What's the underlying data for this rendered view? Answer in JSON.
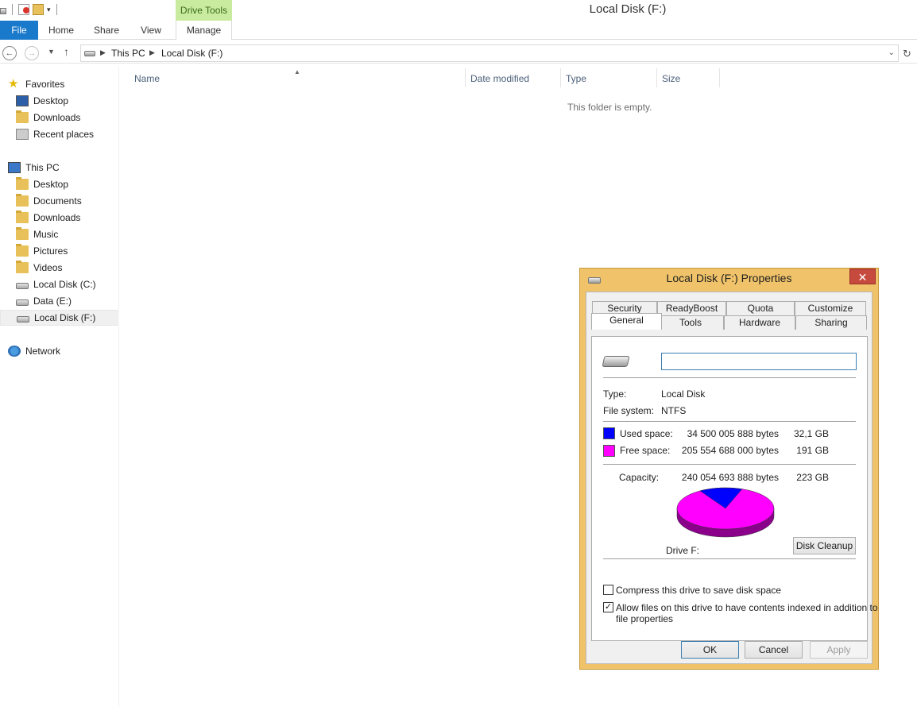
{
  "window": {
    "title": "Local Disk (F:)",
    "contextual_tab": "Drive Tools"
  },
  "ribbon": {
    "tabs": [
      "File",
      "Home",
      "Share",
      "View",
      "Manage"
    ]
  },
  "address": {
    "breadcrumb": [
      "This PC",
      "Local Disk (F:)"
    ]
  },
  "nav": {
    "favorites_header": "Favorites",
    "favorites": [
      "Desktop",
      "Downloads",
      "Recent places"
    ],
    "thispc_header": "This PC",
    "thispc_items": [
      "Desktop",
      "Documents",
      "Downloads",
      "Music",
      "Pictures",
      "Videos",
      "Local Disk (C:)",
      "Data (E:)",
      "Local Disk (F:)"
    ],
    "network": "Network",
    "selected": "Local Disk (F:)"
  },
  "content": {
    "columns": [
      "Name",
      "Date modified",
      "Type",
      "Size"
    ],
    "empty_message": "This folder is empty."
  },
  "dialog": {
    "title": "Local Disk (F:) Properties",
    "close_glyph": "✕",
    "tabs_row1": [
      "Security",
      "ReadyBoost",
      "Quota",
      "Customize"
    ],
    "tabs_row2": [
      "General",
      "Tools",
      "Hardware",
      "Sharing"
    ],
    "active_tab": "General",
    "name_value": "",
    "type_label": "Type:",
    "type_value": "Local Disk",
    "fs_label": "File system:",
    "fs_value": "NTFS",
    "used_label": "Used space:",
    "used_bytes": "34 500 005 888 bytes",
    "used_gb": "32,1 GB",
    "free_label": "Free space:",
    "free_bytes": "205 554 688 000 bytes",
    "free_gb": "191 GB",
    "capacity_label": "Capacity:",
    "capacity_bytes": "240 054 693 888 bytes",
    "capacity_gb": "223 GB",
    "drive_label": "Drive F:",
    "disk_cleanup": "Disk Cleanup",
    "compress_label": "Compress this drive to save disk space",
    "compress_checked": false,
    "index_label_1": "Allow files on this drive to have contents indexed in addition to",
    "index_label_2": "file properties",
    "index_checked": true,
    "ok": "OK",
    "cancel": "Cancel",
    "apply": "Apply"
  },
  "pie": {
    "used_fraction": 0.1437,
    "used_color": "#0000ff",
    "free_color": "#ff00ff",
    "free_shadow": "#8b008b"
  }
}
